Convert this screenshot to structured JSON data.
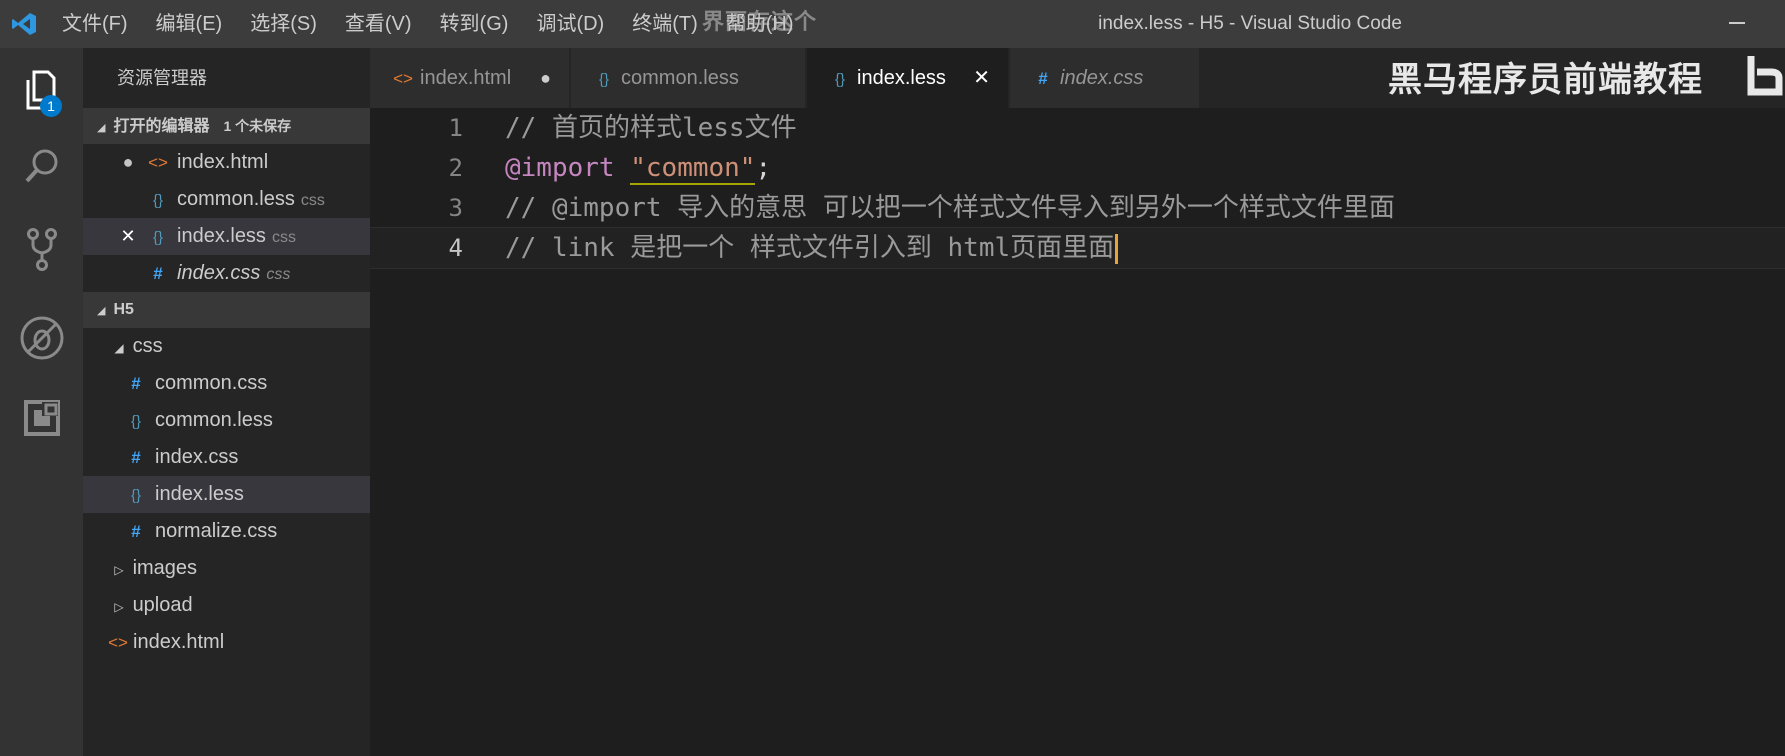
{
  "titlebar": {
    "menu": [
      "文件(F)",
      "编辑(E)",
      "选择(S)",
      "查看(V)",
      "转到(G)",
      "调试(D)",
      "终端(T)",
      "帮助(H)"
    ],
    "window_title": "index.less - H5 - Visual Studio Code",
    "overlay_text": "界面存这个"
  },
  "activitybar": {
    "explorer_badge": "1",
    "icons": [
      "files-icon",
      "search-icon",
      "source-control-icon",
      "debug-icon",
      "extensions-icon"
    ]
  },
  "sidebar": {
    "title": "资源管理器",
    "open_editors": {
      "header": "打开的编辑器",
      "unsaved": "1 个未保存",
      "items": [
        {
          "marker": "●",
          "icon": "html",
          "name": "index.html",
          "desc": ""
        },
        {
          "marker": "",
          "icon": "less",
          "name": "common.less",
          "desc": "css"
        },
        {
          "marker": "✕",
          "icon": "less",
          "name": "index.less",
          "desc": "css"
        },
        {
          "marker": "",
          "icon": "css",
          "name": "index.css",
          "desc": "css"
        }
      ]
    },
    "project": {
      "header": "H5",
      "css_folder": "css",
      "css_files": [
        "common.css",
        "common.less",
        "index.css",
        "index.less",
        "normalize.css"
      ],
      "images_folder": "images",
      "upload_folder": "upload",
      "root_file": "index.html"
    }
  },
  "tabs": [
    {
      "icon": "html",
      "label": "index.html"
    },
    {
      "icon": "less",
      "label": "common.less"
    },
    {
      "icon": "less",
      "label": "index.less"
    },
    {
      "icon": "css",
      "label": "index.css"
    }
  ],
  "watermark": "黑马程序员前端教程",
  "editor": {
    "line_numbers": [
      "1",
      "2",
      "3",
      "4"
    ],
    "line1": "// 首页的样式less文件",
    "line2": {
      "keyword": "@import",
      "string": "\"common\"",
      "end": ";"
    },
    "line3": "// @import 导入的意思 可以把一个样式文件导入到另外一个样式文件里面",
    "line4": "// link 是把一个 样式文件引入到 html页面里面"
  },
  "colors": {
    "accent": "#007acc",
    "comment": "#9a9a9a",
    "keyword": "#c586c0",
    "string": "#ce9178",
    "html_icon": "#e37933",
    "less_icon": "#519aba",
    "css_icon": "#42a5f5"
  }
}
